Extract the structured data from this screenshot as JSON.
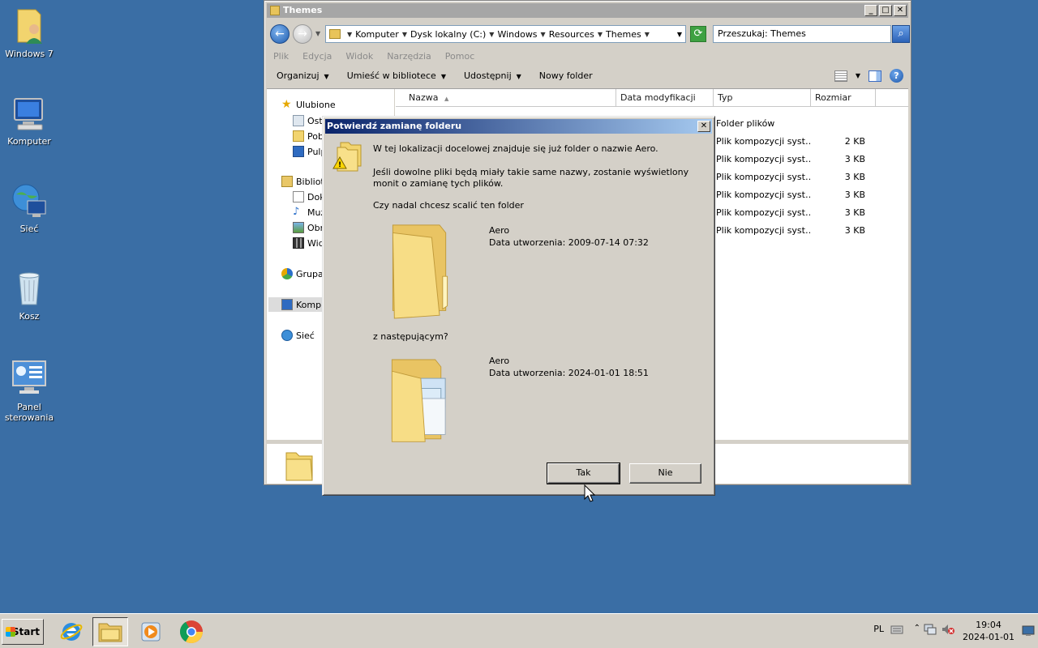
{
  "desktop": {
    "icons": [
      {
        "label": "Windows 7"
      },
      {
        "label": "Komputer"
      },
      {
        "label": "Sieć"
      },
      {
        "label": "Kosz"
      },
      {
        "label": "Panel sterowania"
      }
    ]
  },
  "explorer": {
    "title": "Themes",
    "window_buttons": {
      "minimize": "_",
      "maximize": "□",
      "close": "✕"
    },
    "breadcrumb": [
      "Komputer",
      "Dysk lokalny (C:)",
      "Windows",
      "Resources",
      "Themes"
    ],
    "search_placeholder": "Przeszukaj: Themes",
    "menu": [
      "Plik",
      "Edycja",
      "Widok",
      "Narzędzia",
      "Pomoc"
    ],
    "toolbar": {
      "organize": "Organizuj",
      "include": "Umieść w bibliotece",
      "share": "Udostępnij",
      "new_folder": "Nowy folder"
    },
    "nav": {
      "favorites": "Ulubione",
      "fav_items": [
        "Ost",
        "Pob",
        "Pulp"
      ],
      "libraries": "Bibliot",
      "lib_items": [
        "Dok",
        "Muz",
        "Obr",
        "Wid"
      ],
      "homegroup": "Grupa",
      "computer": "Kompu",
      "network": "Sieć"
    },
    "columns": {
      "name": "Nazwa",
      "date": "Data modyfikacji",
      "type": "Typ",
      "size": "Rozmiar"
    },
    "rows": [
      {
        "type": "Folder plików",
        "size": ""
      },
      {
        "type": "Plik kompozycji syst…",
        "size": "2 KB"
      },
      {
        "type": "Plik kompozycji syst…",
        "size": "3 KB"
      },
      {
        "type": "Plik kompozycji syst…",
        "size": "3 KB"
      },
      {
        "type": "Plik kompozycji syst…",
        "size": "3 KB"
      },
      {
        "type": "Plik kompozycji syst…",
        "size": "3 KB"
      },
      {
        "type": "Plik kompozycji syst…",
        "size": "3 KB"
      }
    ]
  },
  "dialog": {
    "title": "Potwierdź zamianę folderu",
    "close": "✕",
    "line1": "W tej lokalizacji docelowej znajduje się już folder o nazwie Aero.",
    "line2": "Jeśli dowolne pliki będą miały takie same nazwy, zostanie wyświetlony monit o zamianę tych plików.",
    "question": "Czy nadal chcesz scalić ten folder",
    "existing": {
      "name": "Aero",
      "date": "Data utworzenia: 2009-07-14 07:32"
    },
    "with_label": "z następującym?",
    "incoming": {
      "name": "Aero",
      "date": "Data utworzenia: 2024-01-01 18:51"
    },
    "yes": "Tak",
    "no": "Nie"
  },
  "taskbar": {
    "start": "Start",
    "lang": "PL",
    "time": "19:04",
    "date": "2024-01-01"
  }
}
